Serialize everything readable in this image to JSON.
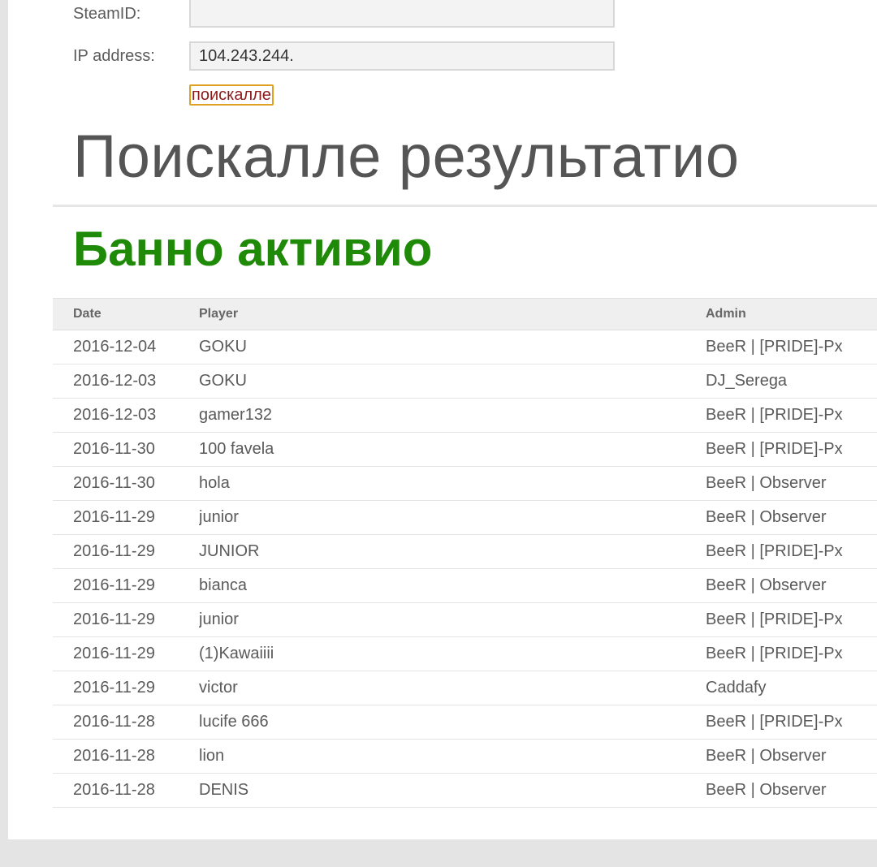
{
  "form": {
    "steamid_label": "SteamID:",
    "steamid_value": "",
    "ip_label": "IP address:",
    "ip_value": "104.243.244.",
    "search_button_label": "поискалле"
  },
  "results": {
    "title": "Поискалле результатио",
    "bans_heading": "Банно активио"
  },
  "table": {
    "headers": {
      "date": "Date",
      "player": "Player",
      "admin": "Admin"
    },
    "rows": [
      {
        "date": "2016-12-04",
        "player": "GOKU",
        "admin": "BeeR | [PRIDE]-Px"
      },
      {
        "date": "2016-12-03",
        "player": "GOKU",
        "admin": "DJ_Serega"
      },
      {
        "date": "2016-12-03",
        "player": "gamer132",
        "admin": "BeeR | [PRIDE]-Px"
      },
      {
        "date": "2016-11-30",
        "player": "100 favela",
        "admin": "BeeR | [PRIDE]-Px"
      },
      {
        "date": "2016-11-30",
        "player": "hola",
        "admin": "BeeR | Observer"
      },
      {
        "date": "2016-11-29",
        "player": "junior",
        "admin": "BeeR | Observer"
      },
      {
        "date": "2016-11-29",
        "player": "JUNIOR",
        "admin": "BeeR | [PRIDE]-Px"
      },
      {
        "date": "2016-11-29",
        "player": "bianca",
        "admin": "BeeR | Observer"
      },
      {
        "date": "2016-11-29",
        "player": "junior",
        "admin": "BeeR | [PRIDE]-Px"
      },
      {
        "date": "2016-11-29",
        "player": "(1)Kawaiiii",
        "admin": "BeeR | [PRIDE]-Px"
      },
      {
        "date": "2016-11-29",
        "player": "victor",
        "admin": "Caddafy"
      },
      {
        "date": "2016-11-28",
        "player": "lucife 666",
        "admin": "BeeR | [PRIDE]-Px"
      },
      {
        "date": "2016-11-28",
        "player": "lion",
        "admin": "BeeR | Observer"
      },
      {
        "date": "2016-11-28",
        "player": "DENIS",
        "admin": "BeeR | Observer"
      }
    ]
  },
  "colors": {
    "bans_heading": "#1f8a07",
    "search_button_border": "#e0a020",
    "search_button_text": "#8b1a1a"
  }
}
